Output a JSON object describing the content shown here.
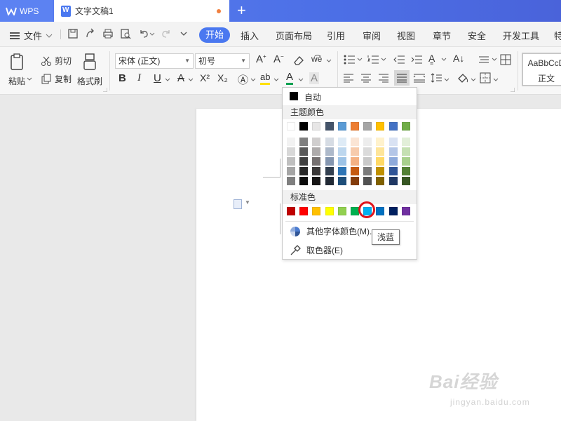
{
  "titlebar": {
    "app_label": "WPS",
    "doc_tab_label": "文字文稿1",
    "new_tab": "+"
  },
  "menubar": {
    "file": "文件",
    "tabs": [
      "开始",
      "插入",
      "页面布局",
      "引用",
      "审阅",
      "视图",
      "章节",
      "安全",
      "开发工具",
      "特"
    ]
  },
  "ribbon": {
    "paste": "粘贴",
    "cut": "剪切",
    "copy": "复制",
    "format_painter": "格式刷",
    "font_name": "宋体 (正文)",
    "font_size": "初号",
    "bold": "B",
    "italic": "I",
    "underline": "U",
    "superscript": "X²",
    "subscript": "X₂",
    "font_color": "A",
    "style_preview": "AaBbCcD",
    "style_name": "正文"
  },
  "color_menu": {
    "auto_label": "自动",
    "theme_label": "主题颜色",
    "standard_label": "标准色",
    "more_colors": "其他字体颜色(M)...",
    "eyedropper": "取色器(E)",
    "theme_top": [
      "#ffffff",
      "#000000",
      "#e7e6e6",
      "#44546a",
      "#5b9bd5",
      "#ed7d31",
      "#a5a5a5",
      "#ffc000",
      "#4472c4",
      "#70ad47"
    ],
    "theme_shades": [
      [
        "#f2f2f2",
        "#7f7f7f",
        "#d0cece",
        "#d6dce4",
        "#deebf6",
        "#fbe5d5",
        "#ededed",
        "#fff2cc",
        "#d9e2f3",
        "#e2efd9"
      ],
      [
        "#d8d8d8",
        "#595959",
        "#aeabab",
        "#adb9ca",
        "#bdd7ee",
        "#f7cbac",
        "#dbdbdb",
        "#fee599",
        "#b4c6e7",
        "#c5e0b3"
      ],
      [
        "#bfbfbf",
        "#3f3f3f",
        "#757070",
        "#8496b0",
        "#9dc3e6",
        "#f4b183",
        "#c9c9c9",
        "#ffd965",
        "#8eaadb",
        "#a8d08d"
      ],
      [
        "#a5a5a5",
        "#262626",
        "#3a3838",
        "#323f4f",
        "#2e75b5",
        "#c55a11",
        "#7b7b7b",
        "#bf9000",
        "#2f5496",
        "#538135"
      ],
      [
        "#7f7f7f",
        "#0c0c0c",
        "#171616",
        "#222a35",
        "#1e4e79",
        "#833c0b",
        "#525252",
        "#7f6000",
        "#1f3864",
        "#375623"
      ]
    ],
    "standard": [
      "#c00000",
      "#ff0000",
      "#ffc000",
      "#ffff00",
      "#92d050",
      "#00b050",
      "#00b0f0",
      "#0070c0",
      "#002060",
      "#7030a0"
    ]
  },
  "tooltip": "浅蓝",
  "watermark": {
    "brand": "Bai经验",
    "url": "jingyan.baidu.com"
  }
}
